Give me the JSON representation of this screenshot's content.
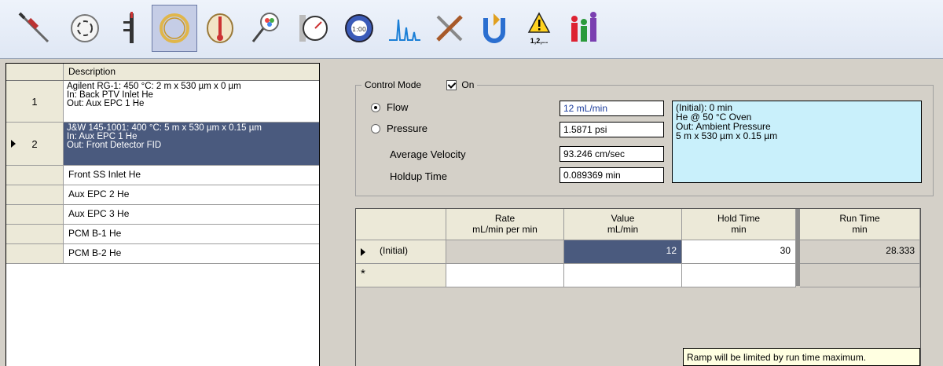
{
  "toolbar": {
    "icons": [
      "syringe-icon",
      "valve-icon",
      "inlet-icon",
      "column-icon",
      "oven-icon",
      "detector-icon",
      "gauge-icon",
      "clock-icon",
      "chromatogram-icon",
      "tools-icon",
      "transfer-icon",
      "warning-icon",
      "bar-chart-icon"
    ],
    "warning_label": "1,2,..."
  },
  "column_list": {
    "header": "Description",
    "rows": [
      {
        "num": "1",
        "lines": [
          "Agilent RG-1: 450 °C: 2 m x 530 µm x 0 µm",
          "In: Back PTV Inlet He",
          "Out: Aux EPC 1 He"
        ]
      },
      {
        "num": "2",
        "lines": [
          "J&W 145-1001: 400 °C: 5 m x 530 µm x 0.15 µm",
          "In: Aux EPC 1 He",
          "Out: Front Detector FID"
        ]
      },
      {
        "num": "",
        "lines": [
          "Front SS Inlet He"
        ]
      },
      {
        "num": "",
        "lines": [
          "Aux EPC 2 He"
        ]
      },
      {
        "num": "",
        "lines": [
          "Aux EPC 3 He"
        ]
      },
      {
        "num": "",
        "lines": [
          "PCM B-1 He"
        ]
      },
      {
        "num": "",
        "lines": [
          "PCM B-2 He"
        ]
      }
    ]
  },
  "control": {
    "group_label": "Control Mode",
    "on_label": "On",
    "flow_label": "Flow",
    "pressure_label": "Pressure",
    "avg_velocity_label": "Average Velocity",
    "holdup_label": "Holdup Time",
    "flow_value": "12 mL/min",
    "pressure_value": "1.5871 psi",
    "avg_velocity_value": "93.246 cm/sec",
    "holdup_value": "0.089369 min",
    "info": [
      "(Initial): 0 min",
      "He @ 50 °C Oven",
      "Out: Ambient Pressure",
      "5 m x 530 µm x 0.15 µm"
    ]
  },
  "ramp_table": {
    "headers": [
      {
        "line1": "Rate",
        "line2": "mL/min per min"
      },
      {
        "line1": "Value",
        "line2": "mL/min"
      },
      {
        "line1": "Hold Time",
        "line2": "min"
      },
      {
        "line1": "Run Time",
        "line2": "min"
      }
    ],
    "rows": [
      {
        "label": "(Initial)",
        "rate": "",
        "value": "12",
        "hold": "30",
        "run": "28.333"
      }
    ],
    "new_row_marker": "*"
  },
  "tooltip": "Ramp will be limited by run time maximum."
}
